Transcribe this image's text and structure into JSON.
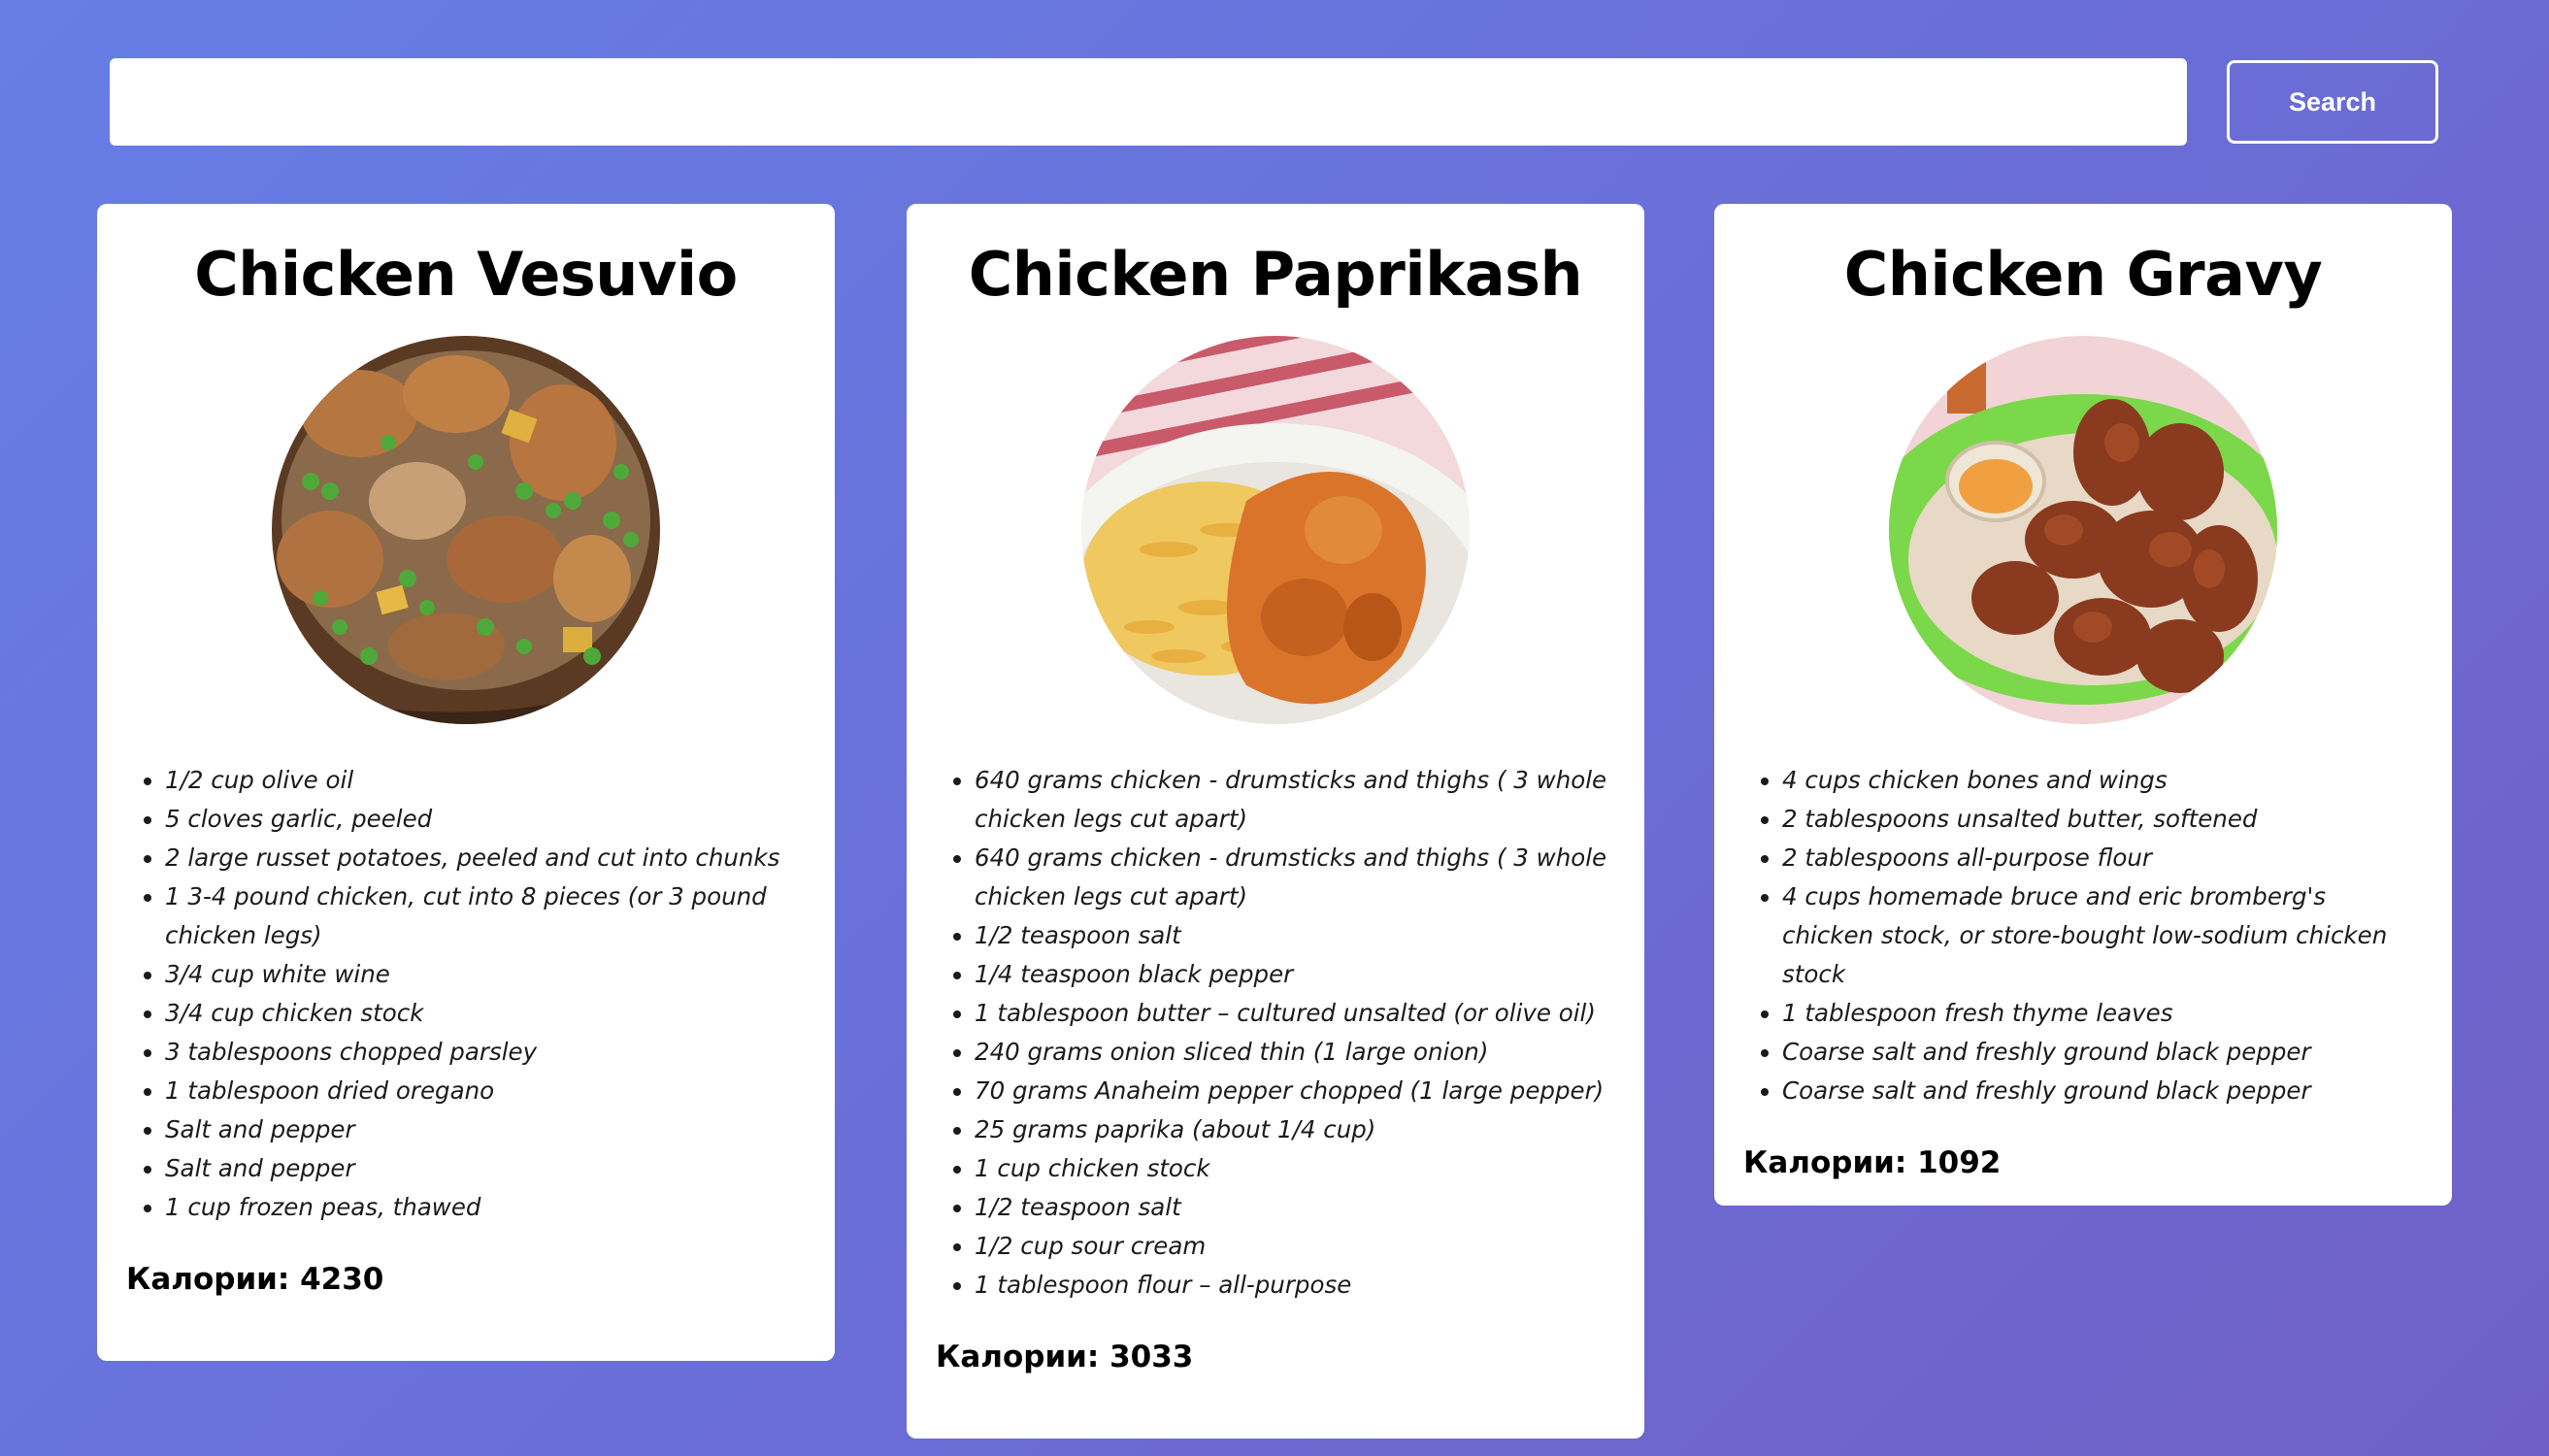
{
  "search": {
    "value": "",
    "placeholder": "",
    "button_label": "Search"
  },
  "calories_label": "Калории:",
  "recipes": [
    {
      "title": "Chicken Vesuvio",
      "image_icon": "chicken-vesuvio-photo",
      "ingredients": [
        "1/2 cup olive oil",
        "5 cloves garlic, peeled",
        "2 large russet potatoes, peeled and cut into chunks",
        "1 3-4 pound chicken, cut into 8 pieces (or 3 pound chicken legs)",
        "3/4 cup white wine",
        "3/4 cup chicken stock",
        "3 tablespoons chopped parsley",
        "1 tablespoon dried oregano",
        "Salt and pepper",
        "Salt and pepper",
        "1 cup frozen peas, thawed"
      ],
      "calories": "Калории: 4230"
    },
    {
      "title": "Chicken Paprikash",
      "image_icon": "chicken-paprikash-photo",
      "ingredients": [
        "640 grams chicken - drumsticks and thighs ( 3 whole chicken legs cut apart)",
        "640 grams chicken - drumsticks and thighs ( 3 whole chicken legs cut apart)",
        "1/2 teaspoon salt",
        "1/4 teaspoon black pepper",
        "1 tablespoon butter – cultured unsalted (or olive oil)",
        "240 grams onion sliced thin (1 large onion)",
        "70 grams Anaheim pepper chopped (1 large pepper)",
        "25 grams paprika (about 1/4 cup)",
        "1 cup chicken stock",
        "1/2 teaspoon salt",
        "1/2 cup sour cream",
        "1 tablespoon flour – all-purpose"
      ],
      "calories": "Калории: 3033"
    },
    {
      "title": "Chicken Gravy",
      "image_icon": "chicken-gravy-photo",
      "ingredients": [
        "4 cups chicken bones and wings",
        "2 tablespoons unsalted butter, softened",
        "2 tablespoons all-purpose flour",
        "4 cups homemade bruce and eric bromberg's chicken stock, or store-bought low-sodium chicken stock",
        "1 tablespoon fresh thyme leaves",
        "Coarse salt and freshly ground black pepper",
        "Coarse salt and freshly ground black pepper"
      ],
      "calories": "Калории: 1092"
    }
  ],
  "colors": {
    "background_start": "#667ee6",
    "background_end": "#7060c6",
    "card": "#ffffff",
    "text": "#000000"
  }
}
